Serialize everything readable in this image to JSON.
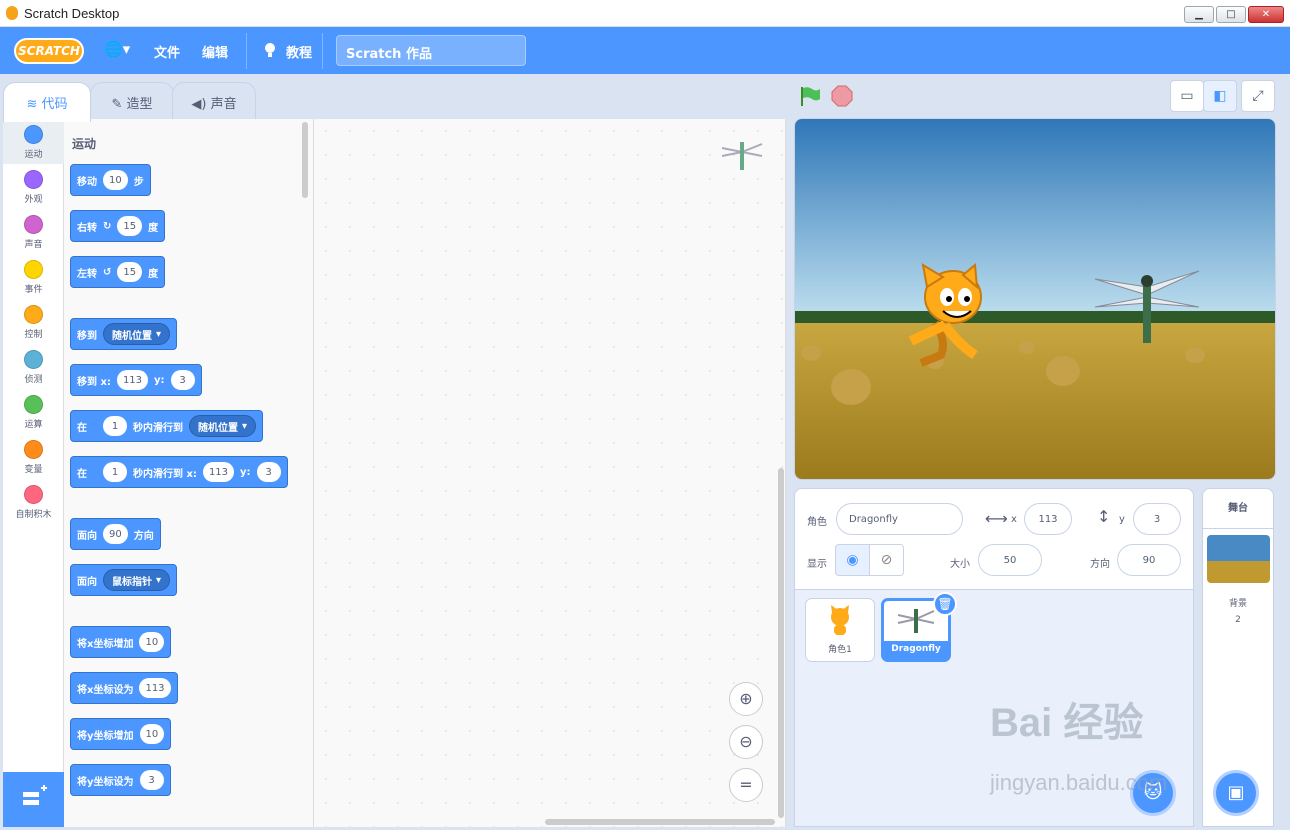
{
  "window": {
    "title": "Scratch Desktop",
    "min": "▁",
    "max": "□",
    "close": "✕"
  },
  "menubar": {
    "logo": "SCRATCH",
    "globe": "🌐▾",
    "file": "文件",
    "edit": "编辑",
    "tutorials": "教程",
    "project_title": "Scratch 作品"
  },
  "tabs": [
    {
      "label": "代码"
    },
    {
      "label": "造型"
    },
    {
      "label": "声音"
    }
  ],
  "categories": [
    {
      "label": "运动",
      "color": "#4c97ff"
    },
    {
      "label": "外观",
      "color": "#9966ff"
    },
    {
      "label": "声音",
      "color": "#cf63cf"
    },
    {
      "label": "事件",
      "color": "#ffd500"
    },
    {
      "label": "控制",
      "color": "#ffab19"
    },
    {
      "label": "侦测",
      "color": "#5cb1d6"
    },
    {
      "label": "运算",
      "color": "#59c059"
    },
    {
      "label": "变量",
      "color": "#ff8c1a"
    },
    {
      "label": "自制积木",
      "color": "#ff6680"
    }
  ],
  "palette": {
    "section": "运动",
    "blocks": {
      "move": {
        "t1": "移动",
        "v": "10",
        "t2": "步"
      },
      "turn_right": {
        "t1": "右转",
        "v": "15",
        "t2": "度"
      },
      "turn_left": {
        "t1": "左转",
        "v": "15",
        "t2": "度"
      },
      "goto": {
        "t1": "移到",
        "dd": "随机位置"
      },
      "goto_xy": {
        "t1": "移到 x:",
        "x": "113",
        "t2": "y:",
        "y": "3"
      },
      "glide": {
        "t1": "在",
        "v": "1",
        "t2": "秒内滑行到",
        "dd": "随机位置"
      },
      "glide_xy": {
        "t1": "在",
        "v": "1",
        "t2": "秒内滑行到 x:",
        "x": "113",
        "t3": "y:",
        "y": "3"
      },
      "point_dir": {
        "t1": "面向",
        "v": "90",
        "t2": "方向"
      },
      "point_towards": {
        "t1": "面向",
        "dd": "鼠标指针"
      },
      "change_x": {
        "t1": "将x坐标增加",
        "v": "10"
      },
      "set_x": {
        "t1": "将x坐标设为",
        "v": "113"
      },
      "change_y": {
        "t1": "将y坐标增加",
        "v": "10"
      },
      "set_y": {
        "t1": "将y坐标设为",
        "v": "3"
      }
    }
  },
  "zoom": {
    "in": "⊕",
    "out": "⊖",
    "reset": "="
  },
  "sprite_info": {
    "sprite_label": "角色",
    "sprite_name": "Dragonfly",
    "x_label": "x",
    "x": "113",
    "y_label": "y",
    "y": "3",
    "show_label": "显示",
    "size_label": "大小",
    "size": "50",
    "direction_label": "方向",
    "direction": "90"
  },
  "sprites": [
    {
      "name": "角色1"
    },
    {
      "name": "Dragonfly"
    }
  ],
  "stage_panel": {
    "title": "舞台",
    "backdrops_label": "背景",
    "backdrops_count": "2"
  },
  "watermark": {
    "line1": "Bai 经验",
    "line2": "jingyan.baidu.com"
  }
}
